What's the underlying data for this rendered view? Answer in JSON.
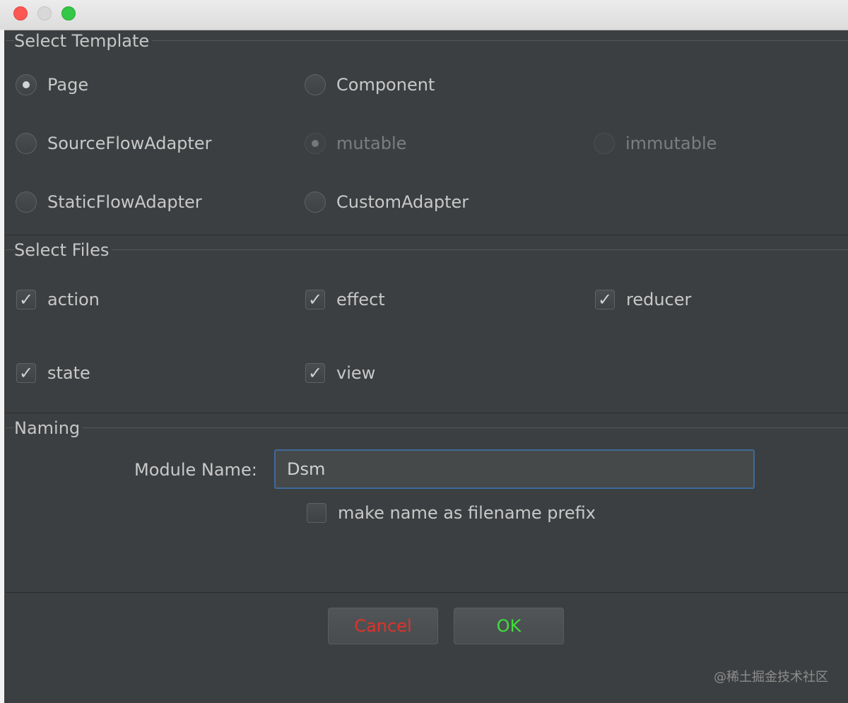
{
  "window": {
    "close": "close",
    "minimize": "minimize",
    "maximize": "maximize"
  },
  "select_template": {
    "legend": "Select Template",
    "options": [
      {
        "label": "Page",
        "checked": true,
        "enabled": true
      },
      {
        "label": "Component",
        "checked": false,
        "enabled": true
      },
      {
        "label": "SourceFlowAdapter",
        "checked": false,
        "enabled": true
      },
      {
        "label": "mutable",
        "checked": true,
        "enabled": false
      },
      {
        "label": "immutable",
        "checked": false,
        "enabled": false
      },
      {
        "label": "StaticFlowAdapter",
        "checked": false,
        "enabled": true
      },
      {
        "label": "CustomAdapter",
        "checked": false,
        "enabled": true
      }
    ]
  },
  "select_files": {
    "legend": "Select Files",
    "files": [
      {
        "label": "action",
        "checked": true
      },
      {
        "label": "effect",
        "checked": true
      },
      {
        "label": "reducer",
        "checked": true
      },
      {
        "label": "state",
        "checked": true
      },
      {
        "label": "view",
        "checked": true
      }
    ]
  },
  "naming": {
    "legend": "Naming",
    "module_label": "Module Name:",
    "module_value": "Dsm",
    "prefix_label": "make name as filename prefix",
    "prefix_checked": false
  },
  "buttons": {
    "cancel": "Cancel",
    "ok": "OK"
  },
  "watermark": "@稀土掘金技术社区",
  "icons": {
    "check": "checkmark-icon"
  },
  "colors": {
    "cancel": "#e0322b",
    "ok": "#3ddf3d",
    "focus": "#3e6a9a"
  }
}
